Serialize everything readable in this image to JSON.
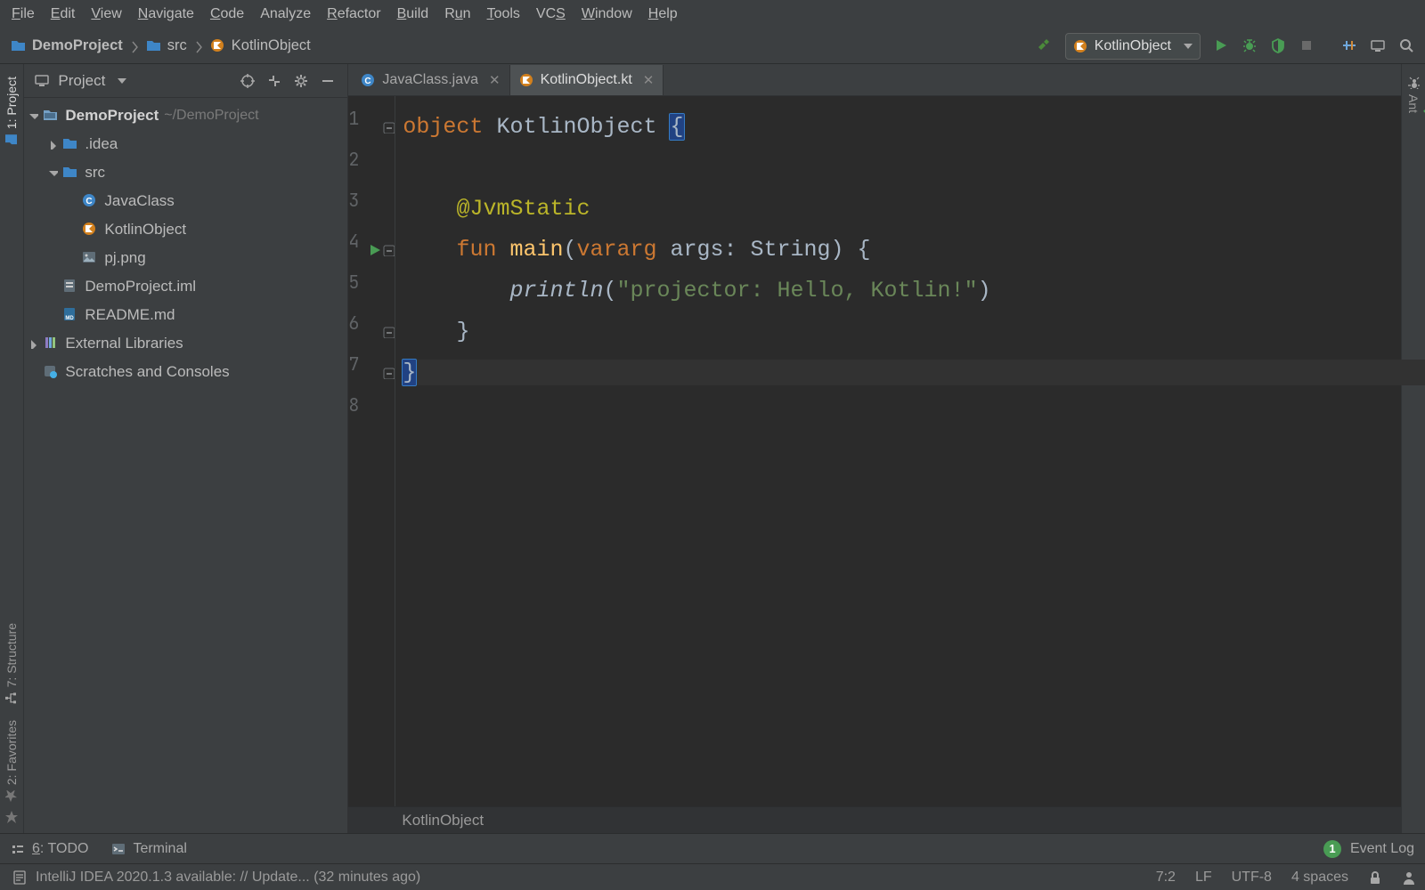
{
  "menu": [
    "File",
    "Edit",
    "View",
    "Navigate",
    "Code",
    "Analyze",
    "Refactor",
    "Build",
    "Run",
    "Tools",
    "VCS",
    "Window",
    "Help"
  ],
  "menu_accel": [
    "F",
    "E",
    "V",
    "N",
    "C",
    "",
    "R",
    "B",
    "u",
    "T",
    "S",
    "W",
    "H"
  ],
  "breadcrumbs": {
    "project": "DemoProject",
    "folder": "src",
    "file": "KotlinObject"
  },
  "run_config": "KotlinObject",
  "project_panel": {
    "title": "Project",
    "tree": [
      {
        "depth": 0,
        "arrow": "down",
        "icon": "project",
        "label": "DemoProject",
        "hint": "~/DemoProject",
        "bold": true
      },
      {
        "depth": 1,
        "arrow": "right",
        "icon": "folder",
        "label": ".idea"
      },
      {
        "depth": 1,
        "arrow": "down",
        "icon": "folder",
        "label": "src"
      },
      {
        "depth": 2,
        "arrow": "",
        "icon": "java",
        "label": "JavaClass"
      },
      {
        "depth": 2,
        "arrow": "",
        "icon": "kotlin",
        "label": "KotlinObject"
      },
      {
        "depth": 2,
        "arrow": "",
        "icon": "image",
        "label": "pj.png"
      },
      {
        "depth": 1,
        "arrow": "",
        "icon": "iml",
        "label": "DemoProject.iml"
      },
      {
        "depth": 1,
        "arrow": "",
        "icon": "md",
        "label": "README.md"
      },
      {
        "depth": 0,
        "arrow": "right",
        "icon": "libs",
        "label": "External Libraries"
      },
      {
        "depth": 0,
        "arrow": "",
        "icon": "scratches",
        "label": "Scratches and Consoles"
      }
    ]
  },
  "tabs": [
    {
      "icon": "java",
      "label": "JavaClass.java",
      "active": false
    },
    {
      "icon": "kotlin",
      "label": "KotlinObject.kt",
      "active": true
    }
  ],
  "code_lines": [
    "1",
    "2",
    "3",
    "4",
    "5",
    "6",
    "7",
    "8"
  ],
  "editor_breadcrumb": "KotlinObject",
  "left_tools": {
    "project": "1: Project",
    "structure": "7: Structure",
    "favorites": "2: Favorites"
  },
  "right_tools": {
    "ant": "Ant"
  },
  "bottom_tools": {
    "todo": "6: TODO",
    "terminal": "Terminal",
    "event_log": "Event Log",
    "event_count": "1"
  },
  "status": {
    "message": "IntelliJ IDEA 2020.1.3 available: // Update... (32 minutes ago)",
    "pos": "7:2",
    "eol": "LF",
    "enc": "UTF-8",
    "indent": "4 spaces"
  },
  "code": {
    "l1_kw": "object",
    "l1_name": " KotlinObject ",
    "l1_br": "{",
    "l3_ann": "@JvmStatic",
    "l4_kw": "fun",
    "l4_fn": " main",
    "l4_p1": "(",
    "l4_kw2": "vararg",
    "l4_p2": " args: String) {",
    "l5_call": "println",
    "l5_p1": "(",
    "l5_str": "\"projector: Hello, Kotlin!\"",
    "l5_p2": ")",
    "l6": "}",
    "l7": "}"
  }
}
